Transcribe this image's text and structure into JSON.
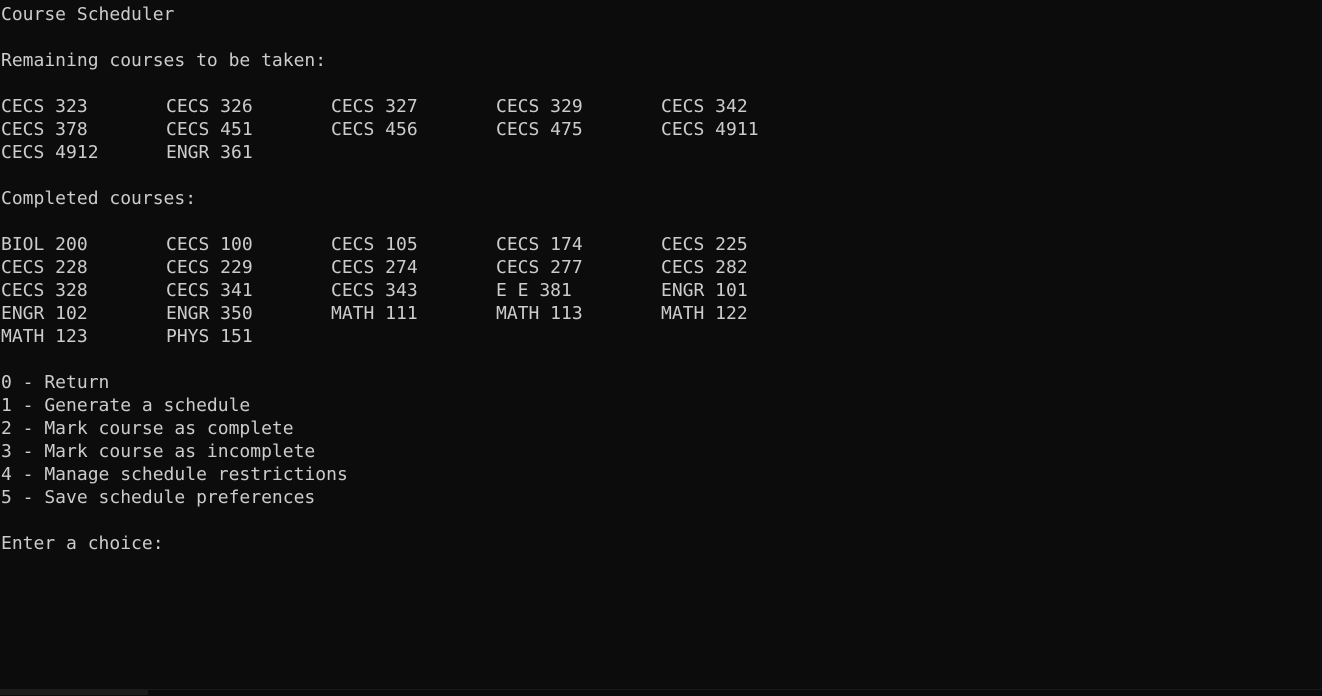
{
  "window": {
    "title": "Course Scheduler"
  },
  "remaining": {
    "heading": "Remaining courses to be taken:",
    "courses": [
      "CECS 323",
      "CECS 326",
      "CECS 327",
      "CECS 329",
      "CECS 342",
      "CECS 378",
      "CECS 451",
      "CECS 456",
      "CECS 475",
      "CECS 4911",
      "CECS 4912",
      "ENGR 361"
    ]
  },
  "completed": {
    "heading": "Completed courses:",
    "courses": [
      "BIOL 200",
      "CECS 100",
      "CECS 105",
      "CECS 174",
      "CECS 225",
      "CECS 228",
      "CECS 229",
      "CECS 274",
      "CECS 277",
      "CECS 282",
      "CECS 328",
      "CECS 341",
      "CECS 343",
      "E E 381",
      "ENGR 101",
      "ENGR 102",
      "ENGR 350",
      "MATH 111",
      "MATH 113",
      "MATH 122",
      "MATH 123",
      "PHYS 151"
    ]
  },
  "menu": {
    "options": [
      "0 - Return",
      "1 - Generate a schedule",
      "2 - Mark course as complete",
      "3 - Mark course as incomplete",
      "4 - Manage schedule restrictions",
      "5 - Save schedule preferences"
    ]
  },
  "prompt": {
    "label": "Enter a choice: ",
    "value": ""
  },
  "colors": {
    "background": "#0c0c0c",
    "text": "#cccccc"
  }
}
